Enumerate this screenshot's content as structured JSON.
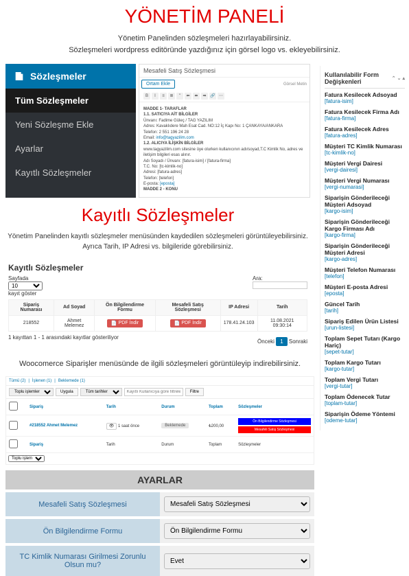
{
  "header": {
    "title": "YÖNETİM PANELİ",
    "subtitle_line1": "Yönetim Panelinden sözleşmeleri hazırlayabilirsiniz.",
    "subtitle_line2": "Sözleşmeleri wordpress editöründe yazdığınız için görsel logo vs. ekleyebilirsiniz."
  },
  "sidebar": {
    "head": "Sözleşmeler",
    "items": [
      {
        "label": "Tüm Sözleşmeler",
        "active": true
      },
      {
        "label": "Yeni Sözleşme Ekle",
        "active": false
      },
      {
        "label": "Ayarlar",
        "active": false
      },
      {
        "label": "Kayıtlı Sözleşmeler",
        "active": false
      }
    ]
  },
  "editor": {
    "doc_title": "Mesafeli Satış Sözleşmesi",
    "add_media": "Ortam Ekle",
    "tabs": {
      "visual": "Görsel",
      "text": "Metin"
    },
    "content": {
      "madde1": "MADDE 1- TARAFLAR",
      "s11": "1.1. SATICIYA AİT BİLGİLER",
      "unvani": "Ünvanı:",
      "unvani_val": "Fadime Güleç / TAG YAZILIM",
      "adres": "Adres: Kavaklıdere Mah Esat Cad. NO:12 İç Kapı No: 1 ÇANKAYA/ANKARA",
      "tel": "Telefon: 2 551 196 24 28",
      "email_lbl": "Email:",
      "email": "info@tagyazilim.com",
      "s12": "1.2. ALICIYA İLİŞKİN BİLGİLER",
      "note": "www.tagyazilim.com sitesine üye olurken kullanıcının adı/soyad,T.C Kimlik No, adres ve iletişim bilgileri esas alınır.",
      "adsoyad": "Adı Soyadı / Ünvanı: [fatura-isim] / [fatura-firma]",
      "tcno": "T.C. No: [tc-kimlik-no]",
      "adresi": "Adresi: [fatura-adres]",
      "telefon": "Telefon: [telefon]",
      "eposta_lbl": "E-posta:",
      "eposta": "[eposta]",
      "madde2": "MADDE 2 - KONU"
    }
  },
  "vars": {
    "title": "Kullanılabilir Form Değişkenleri",
    "items": [
      {
        "t": "Fatura Kesilecek Adsoyad",
        "c": "[fatura-isim]"
      },
      {
        "t": "Fatura Kesilecek Firma Adı",
        "c": "[fatura-firma]"
      },
      {
        "t": "Fatura Kesilecek Adres",
        "c": "[fatura-adres]"
      },
      {
        "t": "Müşteri TC Kimlik Numarası",
        "c": "[tc-kimlik-no]"
      },
      {
        "t": "Müşteri Vergi Dairesi",
        "c": "[vergi-dairesi]"
      },
      {
        "t": "Müşteri Vergi Numarası",
        "c": "[vergi-numarasi]"
      },
      {
        "t": "Siparişin Gönderileceği Müşteri Adsoyad",
        "c": "[kargo-isim]"
      },
      {
        "t": "Siparişin Gönderileceği Kargo Firması Adı",
        "c": "[kargo-firma]"
      },
      {
        "t": "Siparişin Gönderileceği Müşteri Adresi",
        "c": "[kargo-adres]"
      },
      {
        "t": "Müşteri Telefon Numarası",
        "c": "[telefon]"
      },
      {
        "t": "Müşteri E-posta Adresi",
        "c": "[eposta]"
      },
      {
        "t": "Güncel Tarih",
        "c": "[tarih]"
      },
      {
        "t": "Sipariş Edilen Ürün Listesi",
        "c": "[urun-listesi]"
      },
      {
        "t": "Toplam Sepet Tutarı (Kargo Hariç)",
        "c": "[sepet-tutar]"
      },
      {
        "t": "Toplam Kargo Tutarı",
        "c": "[kargo-tutar]"
      },
      {
        "t": "Toplam Vergi Tutarı",
        "c": "[vergi-tutar]"
      },
      {
        "t": "Toplam Ödenecek Tutar",
        "c": "[toplam-tutar]"
      },
      {
        "t": "Siparişin Ödeme Yöntemi",
        "c": "[odeme-tutar]"
      }
    ]
  },
  "records_section": {
    "title": "Kayıtlı Sözleşmeler",
    "subtitle": "Yönetim Panelinden kayıtlı sözleşmeler menüsünden kaydedilen sözleşmeleri görüntüleyebilirsiniz. Ayrıca Tarih, IP Adresi vs. bilgileride görebilirsiniz.",
    "header": "Kayıtlı Sözleşmeler",
    "page_label": "Sayfada",
    "page_val": "10",
    "page_suffix": "kayıt göster",
    "search_label": "Ara:",
    "cols": [
      "Sipariş Numarası",
      "Ad Soyad",
      "Ön Bilgilendirme Formu",
      "Mesafeli Satış Sözleşmesi",
      "IP Adresi",
      "Tarih"
    ],
    "row": {
      "order": "218552",
      "name": "Ahmet Melemez",
      "pdf": "PDF İndir",
      "ip": "178.41.24.103",
      "date": "11.08.2021 09:30:14"
    },
    "footer_info": "1 kayıttan 1 - 1 arasındaki kayıtlar gösteriliyor",
    "prev": "Önceki",
    "page": "1",
    "next": "Sonraki"
  },
  "woo_text": "Woocomerce Siparişler menüsünde de ilgili sözleşmeleri görüntüleyip indirebilirsiniz.",
  "orders": {
    "tabs": [
      "Tümü (2)",
      "İşlenen (1)",
      "Beklemede (1)"
    ],
    "bulk": "Toplu işlemler",
    "apply": "Uygula",
    "all_dates": "Tüm tarihler",
    "filter_ph": "Kayıtlı Kullanıcıya göre filtrele",
    "filter": "Filtre",
    "cols": [
      "",
      "Sipariş",
      "Tarih",
      "Durum",
      "Toplam",
      "Sözleşmeler"
    ],
    "row": {
      "order": "#218552 Ahmet Melemez",
      "date": "1 saat önce",
      "status": "Beklemede",
      "total": "₺200,00",
      "btn1": "Ön Bilgilendirme Sözleşmesi",
      "btn2": "Mesafeli Satış Sözleşmesi"
    },
    "foot": {
      "order": "Sipariş",
      "date": "Tarih",
      "status": "Durum",
      "total": "Toplam",
      "soz": "Sözleşmeler"
    },
    "bulk2": "Toplu işlem"
  },
  "settings": {
    "title": "AYARLAR",
    "rows": [
      {
        "label": "Mesafeli Satış Sözleşmesi",
        "value": "Mesafeli Satış Sözleşmesi"
      },
      {
        "label": "Ön Bilgilendirme Formu",
        "value": "Ön Bilgilendirme Formu"
      },
      {
        "label": "TC Kimlik Numarası Girilmesi Zorunlu Olsun mu?",
        "value": "Evet"
      }
    ]
  }
}
